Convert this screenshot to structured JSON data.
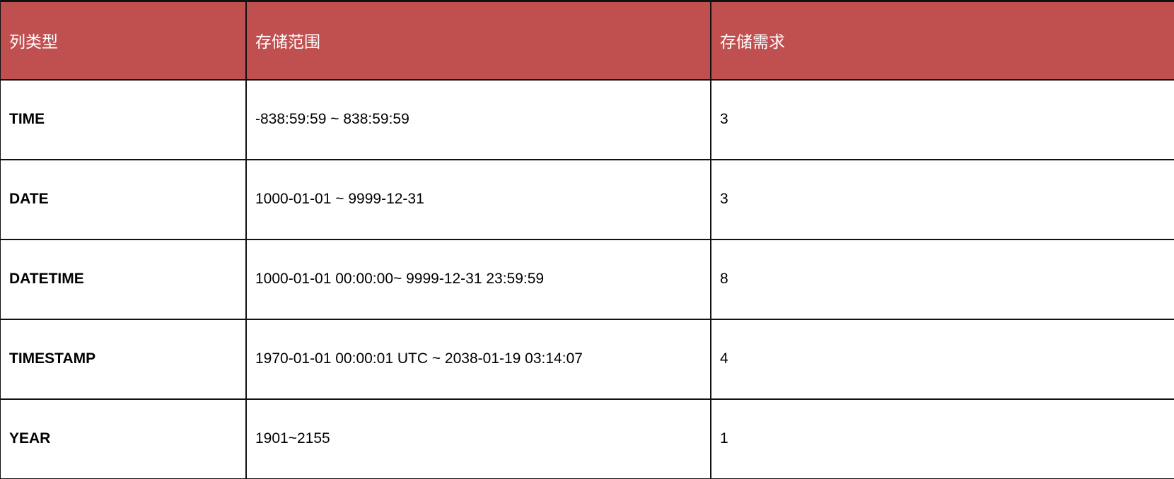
{
  "table": {
    "headers": [
      "列类型",
      "存储范围",
      "存储需求"
    ],
    "rows": [
      {
        "type": "TIME",
        "range": "-838:59:59 ~  838:59:59",
        "storage": "3"
      },
      {
        "type": "DATE",
        "range": "1000-01-01 ~  9999-12-31",
        "storage": "3"
      },
      {
        "type": "DATETIME",
        "range": "1000-01-01 00:00:00~  9999-12-31 23:59:59",
        "storage": "8"
      },
      {
        "type": "TIMESTAMP",
        "range": "1970-01-01 00:00:01 UTC ~ 2038-01-19 03:14:07",
        "storage": "4"
      },
      {
        "type": "YEAR",
        "range": "1901~2155",
        "storage": "1"
      }
    ]
  },
  "colors": {
    "header_bg": "#c0504f",
    "header_text": "#ffffff",
    "border": "#111111"
  }
}
